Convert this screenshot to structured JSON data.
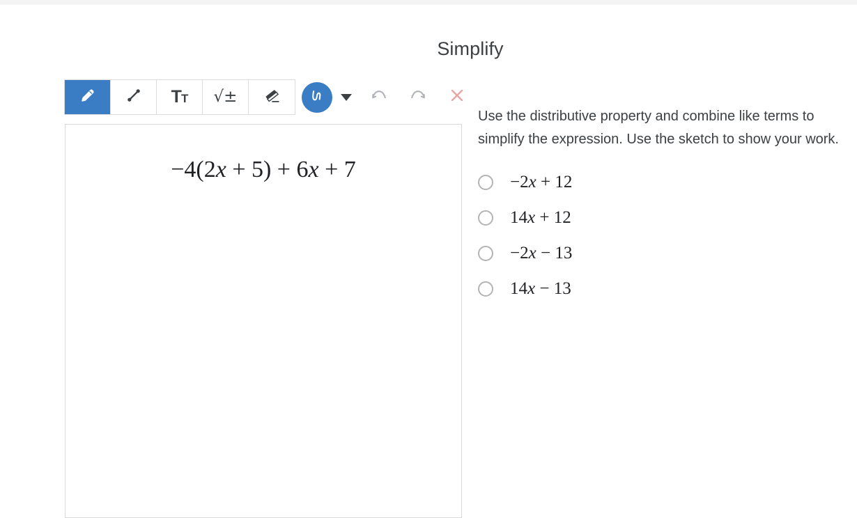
{
  "colors": {
    "accent_blue": "#3b7dc4",
    "close_red": "#e9a3a0",
    "icon_grey": "#b0b3b8",
    "text_primary": "#3c4043",
    "border_grey": "#dadce0",
    "top_strip": "#f4f4f4"
  },
  "header": {
    "title": "Simplify"
  },
  "toolbar": {
    "tools": [
      {
        "name": "pencil-tool",
        "icon": "pencil-icon",
        "label": "Pencil",
        "active": true
      },
      {
        "name": "line-tool",
        "icon": "line-icon",
        "label": "Line",
        "active": false
      },
      {
        "name": "text-tool",
        "icon": "text-icon",
        "label": "Tt",
        "active": false
      },
      {
        "name": "math-tool",
        "icon": "square-root-plus-minus-icon",
        "label": "√±",
        "active": false
      },
      {
        "name": "eraser-tool",
        "icon": "eraser-icon",
        "label": "Eraser",
        "active": false
      }
    ],
    "stroke_button": {
      "name": "stroke-style-button",
      "icon": "scribble-icon",
      "label": "Stroke style"
    },
    "stroke_dropdown": {
      "name": "stroke-style-dropdown",
      "icon": "chevron-down-icon",
      "label": "Stroke options"
    },
    "undo": {
      "name": "undo-button",
      "icon": "undo-icon",
      "label": "Undo",
      "enabled": false
    },
    "redo": {
      "name": "redo-button",
      "icon": "redo-icon",
      "label": "Redo",
      "enabled": false
    },
    "close": {
      "name": "close-button",
      "icon": "close-icon",
      "label": "Close sketch"
    }
  },
  "sketch": {
    "expression": "−4(2x + 5) + 6x + 7",
    "expression_parts": {
      "lead": "−4(2",
      "var1": "x",
      "mid": " + 5) + 6",
      "var2": "x",
      "tail": " + 7"
    }
  },
  "question": {
    "text": "Use the distributive property and combine like terms to simplify the expression. Use the sketch to show your work.",
    "options": [
      {
        "id": "option-a",
        "text": "−2x + 12",
        "parts": {
          "lead": "−2",
          "var": "x",
          "tail": " + 12"
        },
        "selected": false
      },
      {
        "id": "option-b",
        "text": "14x + 12",
        "parts": {
          "lead": "14",
          "var": "x",
          "tail": " + 12"
        },
        "selected": false
      },
      {
        "id": "option-c",
        "text": "−2x − 13",
        "parts": {
          "lead": "−2",
          "var": "x",
          "tail": " − 13"
        },
        "selected": false
      },
      {
        "id": "option-d",
        "text": "14x − 13",
        "parts": {
          "lead": "14",
          "var": "x",
          "tail": " − 13"
        },
        "selected": false
      }
    ]
  }
}
